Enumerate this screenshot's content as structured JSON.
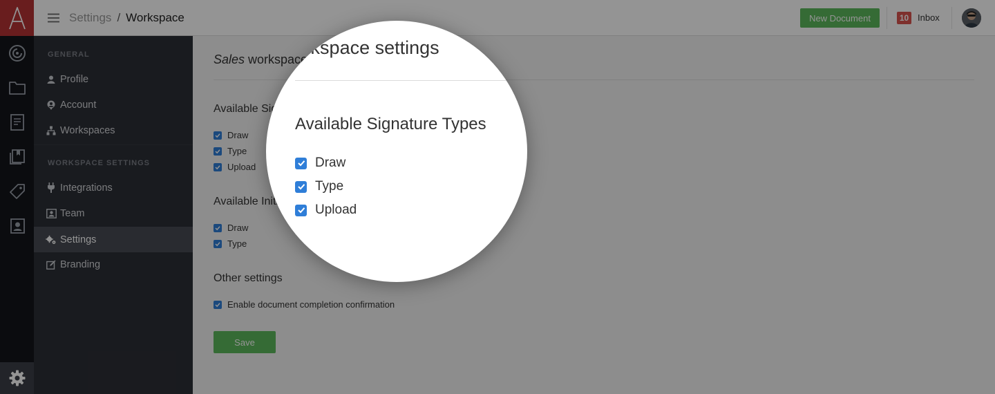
{
  "app": {
    "logo_letter": "A"
  },
  "breadcrumb": {
    "parent": "Settings",
    "separator": "/",
    "current": "Workspace"
  },
  "topbar": {
    "new_document_label": "New Document",
    "inbox_count": "10",
    "inbox_label": "Inbox"
  },
  "sidebar": {
    "general_heading": "GENERAL",
    "general_items": [
      {
        "label": "Profile",
        "icon": "user-icon"
      },
      {
        "label": "Account",
        "icon": "account-icon"
      },
      {
        "label": "Workspaces",
        "icon": "sitemap-icon"
      }
    ],
    "workspace_heading": "WORKSPACE SETTINGS",
    "workspace_items": [
      {
        "label": "Integrations",
        "icon": "plug-icon"
      },
      {
        "label": "Team",
        "icon": "team-icon"
      },
      {
        "label": "Settings",
        "icon": "gears-icon",
        "active": true
      },
      {
        "label": "Branding",
        "icon": "edit-icon"
      }
    ]
  },
  "main": {
    "title_italic": "Sales",
    "title_rest": " workspace settings",
    "signature_types_title": "Available Signature Types",
    "signature_types": [
      "Draw",
      "Type",
      "Upload"
    ],
    "initial_types_title": "Available Initial Types",
    "initial_types": [
      "Draw",
      "Type"
    ],
    "other_title": "Other settings",
    "other_options": [
      "Enable document completion confirmation"
    ],
    "save_label": "Save"
  },
  "colors": {
    "accent_red": "#b53334",
    "primary_green": "#5cb85c",
    "checkbox_blue": "#2f7ed8",
    "sidebar_bg": "#2c2f36",
    "rail_bg": "#14161b"
  }
}
